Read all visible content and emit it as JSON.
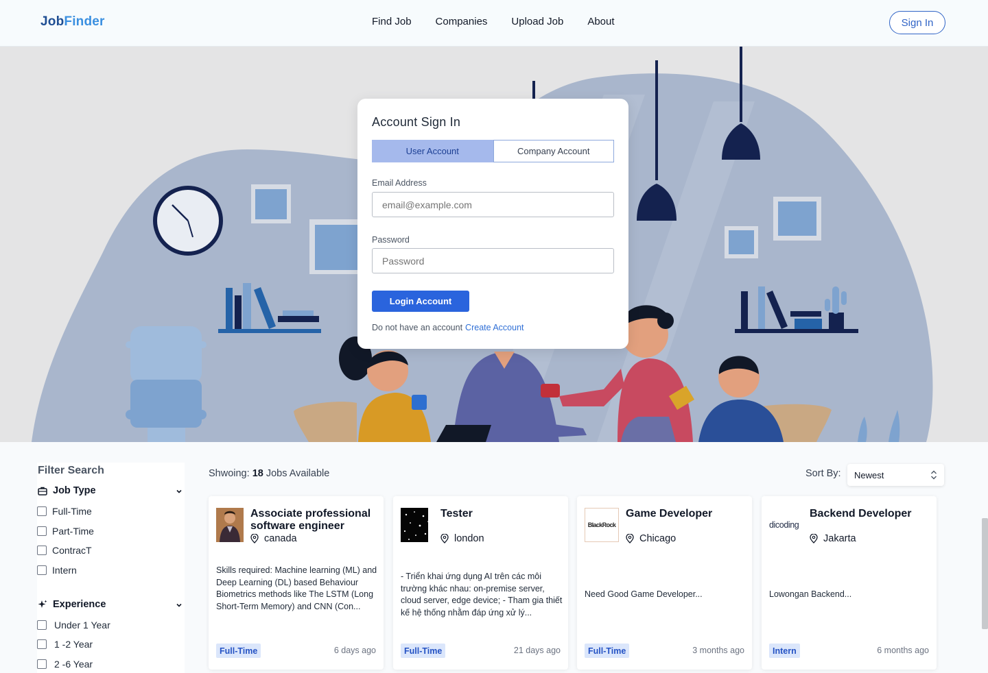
{
  "header": {
    "logo_part1": "Job",
    "logo_part2": "Finder",
    "nav": [
      "Find Job",
      "Companies",
      "Upload Job",
      "About"
    ],
    "sign_in": "Sign In"
  },
  "signin_card": {
    "title": "Account Sign In",
    "tab_user": "User Account",
    "tab_company": "Company Account",
    "email_label": "Email Address",
    "email_placeholder": "email@example.com",
    "password_label": "Password",
    "password_placeholder": "Password",
    "login_button": "Login Account",
    "no_account_text": "Do not have an account",
    "create_account_link": "Create Account"
  },
  "filter": {
    "title": "Filter Search",
    "job_type": {
      "label": "Job Type",
      "options": [
        "Full-Time",
        "Part-Time",
        "ContracT",
        "Intern"
      ]
    },
    "experience": {
      "label": "Experience",
      "options": [
        "Under 1 Year",
        "1 -2 Year",
        "2 -6 Year"
      ]
    }
  },
  "results": {
    "showing_label": "Shwoing:",
    "count": "18",
    "jobs_available": "Jobs Available",
    "sort_label": "Sort By:",
    "sort_value": "Newest"
  },
  "jobs": [
    {
      "title": "Associate professional software engineer",
      "location": "canada",
      "description": "Skills required: Machine learning (ML) and Deep Learning (DL) based Behaviour Biometrics methods like The LSTM (Long Short-Term Memory) and CNN (Con...",
      "type": "Full-Time",
      "posted": "6 days ago"
    },
    {
      "title": "Tester",
      "location": "london",
      "description": "- Triển khai ứng dụng AI trên các môi trường khác nhau: on-premise server, cloud server, edge device; - Tham gia thiết kế hệ thống nhằm đáp ứng xử lý...",
      "type": "Full-Time",
      "posted": "21 days ago"
    },
    {
      "title": "Game Developer",
      "location": "Chicago",
      "description": "Need Good Game Developer...",
      "type": "Full-Time",
      "posted": "3 months ago",
      "logo_text": "BlackRock"
    },
    {
      "title": "Backend Developer",
      "location": "Jakarta",
      "description": "Lowongan Backend...",
      "type": "Intern",
      "posted": "6 months ago",
      "logo_text": "dicoding"
    }
  ],
  "colors": {
    "primary": "#2a64dd",
    "logo_dark": "#1f4e93",
    "logo_light": "#3a8fe0",
    "hero_blob": "#a9b6cc",
    "badge_bg": "#dbe6fb"
  }
}
